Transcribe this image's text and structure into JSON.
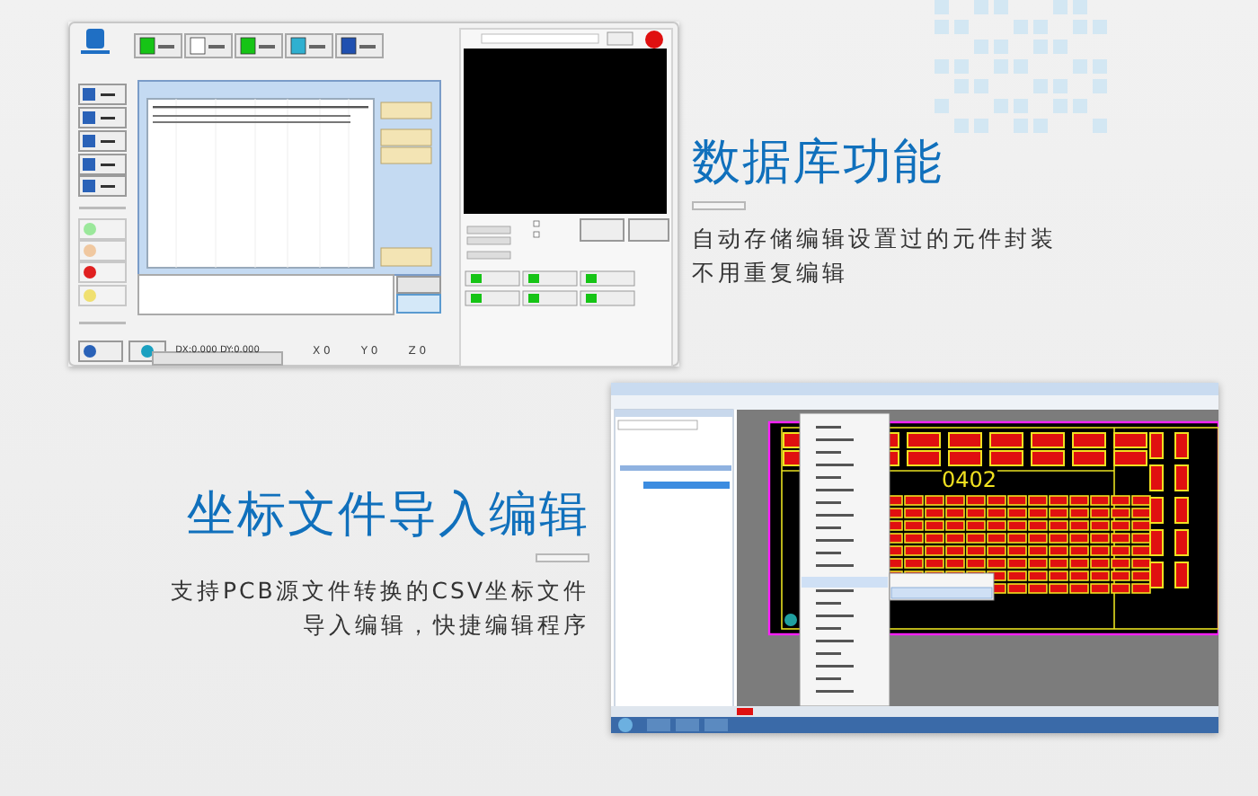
{
  "database_feature": {
    "title": "数据库功能",
    "description": [
      "自动存储编辑设置过的元件封装",
      "不用重复编辑"
    ]
  },
  "import_feature": {
    "title": "坐标文件导入编辑",
    "description": [
      "支持PCB源文件转换的CSV坐标文件",
      "导入编辑，快捷编辑程序"
    ]
  },
  "mounter_software": {
    "offset_readout": "DX:0.000 DY:0.000",
    "coordinates": [
      "X 0",
      "Y 0",
      "Z 0"
    ]
  },
  "pcb_software": {
    "board_label": "0402"
  }
}
